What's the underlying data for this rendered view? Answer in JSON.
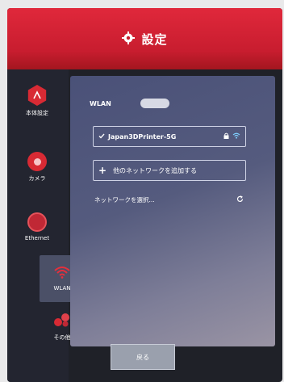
{
  "header": {
    "title": "設定",
    "icon": "gear-icon"
  },
  "sidebar": {
    "items": [
      {
        "label": "本体設定",
        "icon": "printer-icon"
      },
      {
        "label": "カメラ",
        "icon": "camera-icon"
      },
      {
        "label": "Ethernet",
        "icon": "globe-icon"
      },
      {
        "label": "WLAN",
        "icon": "wifi-icon",
        "active": true
      },
      {
        "label": "その他",
        "icon": "more-icon"
      }
    ]
  },
  "wlan": {
    "label": "WLAN",
    "enabled": true,
    "connected_network": "Japan3DPrinter-5G",
    "add_network_label": "他のネットワークを追加する",
    "select_network_label": "ネットワークを選択..."
  },
  "footer": {
    "back_label": "戻る"
  },
  "colors": {
    "accent": "#d82a34",
    "panel": "#4f5679"
  }
}
